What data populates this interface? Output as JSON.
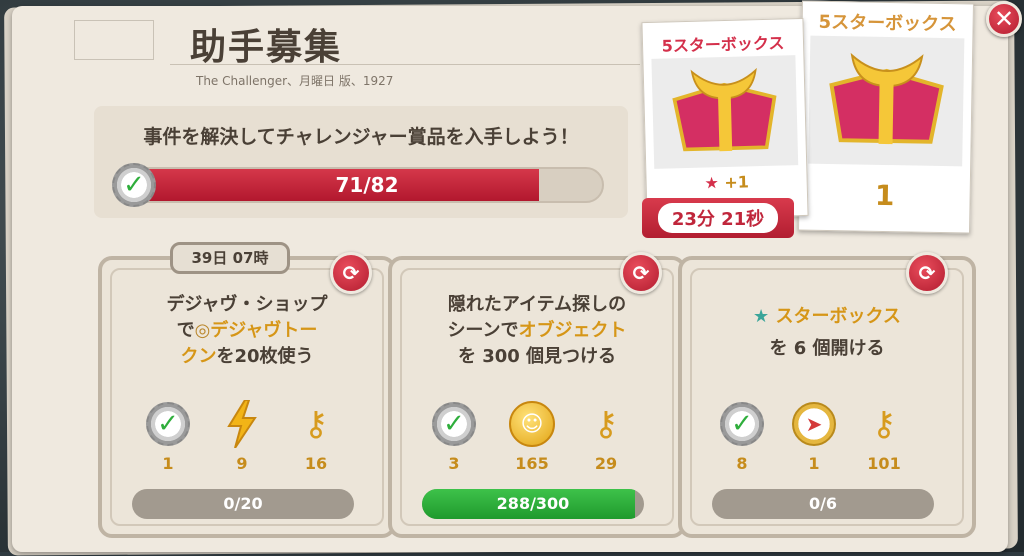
{
  "header": {
    "title": "助手募集",
    "subtitle": "The Challenger、月曜日 版、1927"
  },
  "mission": {
    "text": "事件を解決してチャレンジャー賞品を入手しよう！",
    "progress_label": "71/82",
    "progress_value": 71,
    "progress_max": 82
  },
  "reward_cards": [
    {
      "title": "5スターボックス",
      "bonus": "+1",
      "timer": "23分 21秒"
    },
    {
      "title": "5スターボックス",
      "count": "1"
    }
  ],
  "tasks": [
    {
      "timer": "39日 07時",
      "line1": "デジャヴ・ショップ",
      "line2_prefix": "で",
      "line2_highlight": "デジャヴトー",
      "line3_highlight": "クン",
      "line3_suffix": "を20枚使う",
      "rewards": [
        "1",
        "9",
        "16"
      ],
      "progress_label": "0/20",
      "progress_value": 0,
      "progress_max": 20
    },
    {
      "line1": "隠れたアイテム探しの",
      "line2_prefix": "シーンで",
      "line2_highlight": "オブジェクト",
      "line3": "を 300 個見つける",
      "rewards": [
        "3",
        "165",
        "29"
      ],
      "progress_label": "288/300",
      "progress_value": 288,
      "progress_max": 300
    },
    {
      "line1_highlight": "スターボックス",
      "line2": "を 6 個開ける",
      "rewards": [
        "8",
        "1",
        "101"
      ],
      "progress_label": "0/6",
      "progress_value": 0,
      "progress_max": 6
    }
  ],
  "colors": {
    "accent_red": "#c01f35",
    "highlight": "#d69617",
    "complete_green": "#2fae3c"
  }
}
